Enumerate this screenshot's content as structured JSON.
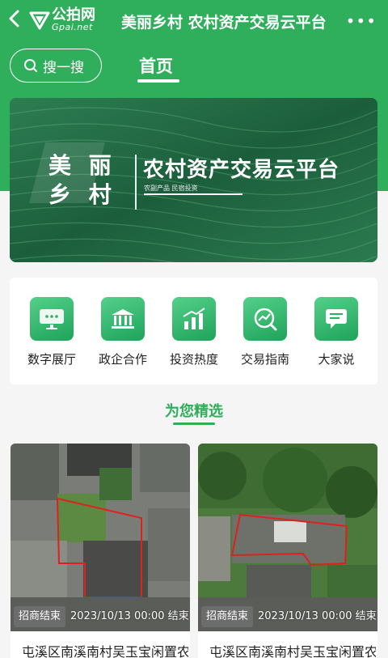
{
  "header": {
    "logo_cn": "公拍网",
    "logo_en": "Gpai.net",
    "title": "美丽乡村 农村资产交易云平台",
    "more": "•••"
  },
  "search": {
    "label": "搜一搜"
  },
  "tabs": [
    {
      "label": "首页",
      "active": true
    }
  ],
  "banner": {
    "slogan_line1": "美 丽",
    "slogan_line2": "乡 村",
    "title": "农村资产交易云平台",
    "subtitle": "农副产品   民宿投资"
  },
  "menu": [
    {
      "label": "数字展厅",
      "icon": "digital-hall-icon"
    },
    {
      "label": "政企合作",
      "icon": "government-building-icon"
    },
    {
      "label": "投资热度",
      "icon": "bar-chart-icon"
    },
    {
      "label": "交易指南",
      "icon": "trend-guide-icon"
    },
    {
      "label": "大家说",
      "icon": "chat-bubble-icon"
    }
  ],
  "section": {
    "title": "为您精选"
  },
  "cards": [
    {
      "status": "招商结束",
      "time": "2023/10/13 00:00 结束",
      "title": "屯溪区南溪南村吴玉宝闲置农房"
    },
    {
      "status": "招商结束",
      "time": "2023/10/13 00:00 结束",
      "title": "屯溪区南溪南村吴玉宝闲置农房"
    }
  ],
  "colors": {
    "brand_green": "#2fae5b"
  }
}
